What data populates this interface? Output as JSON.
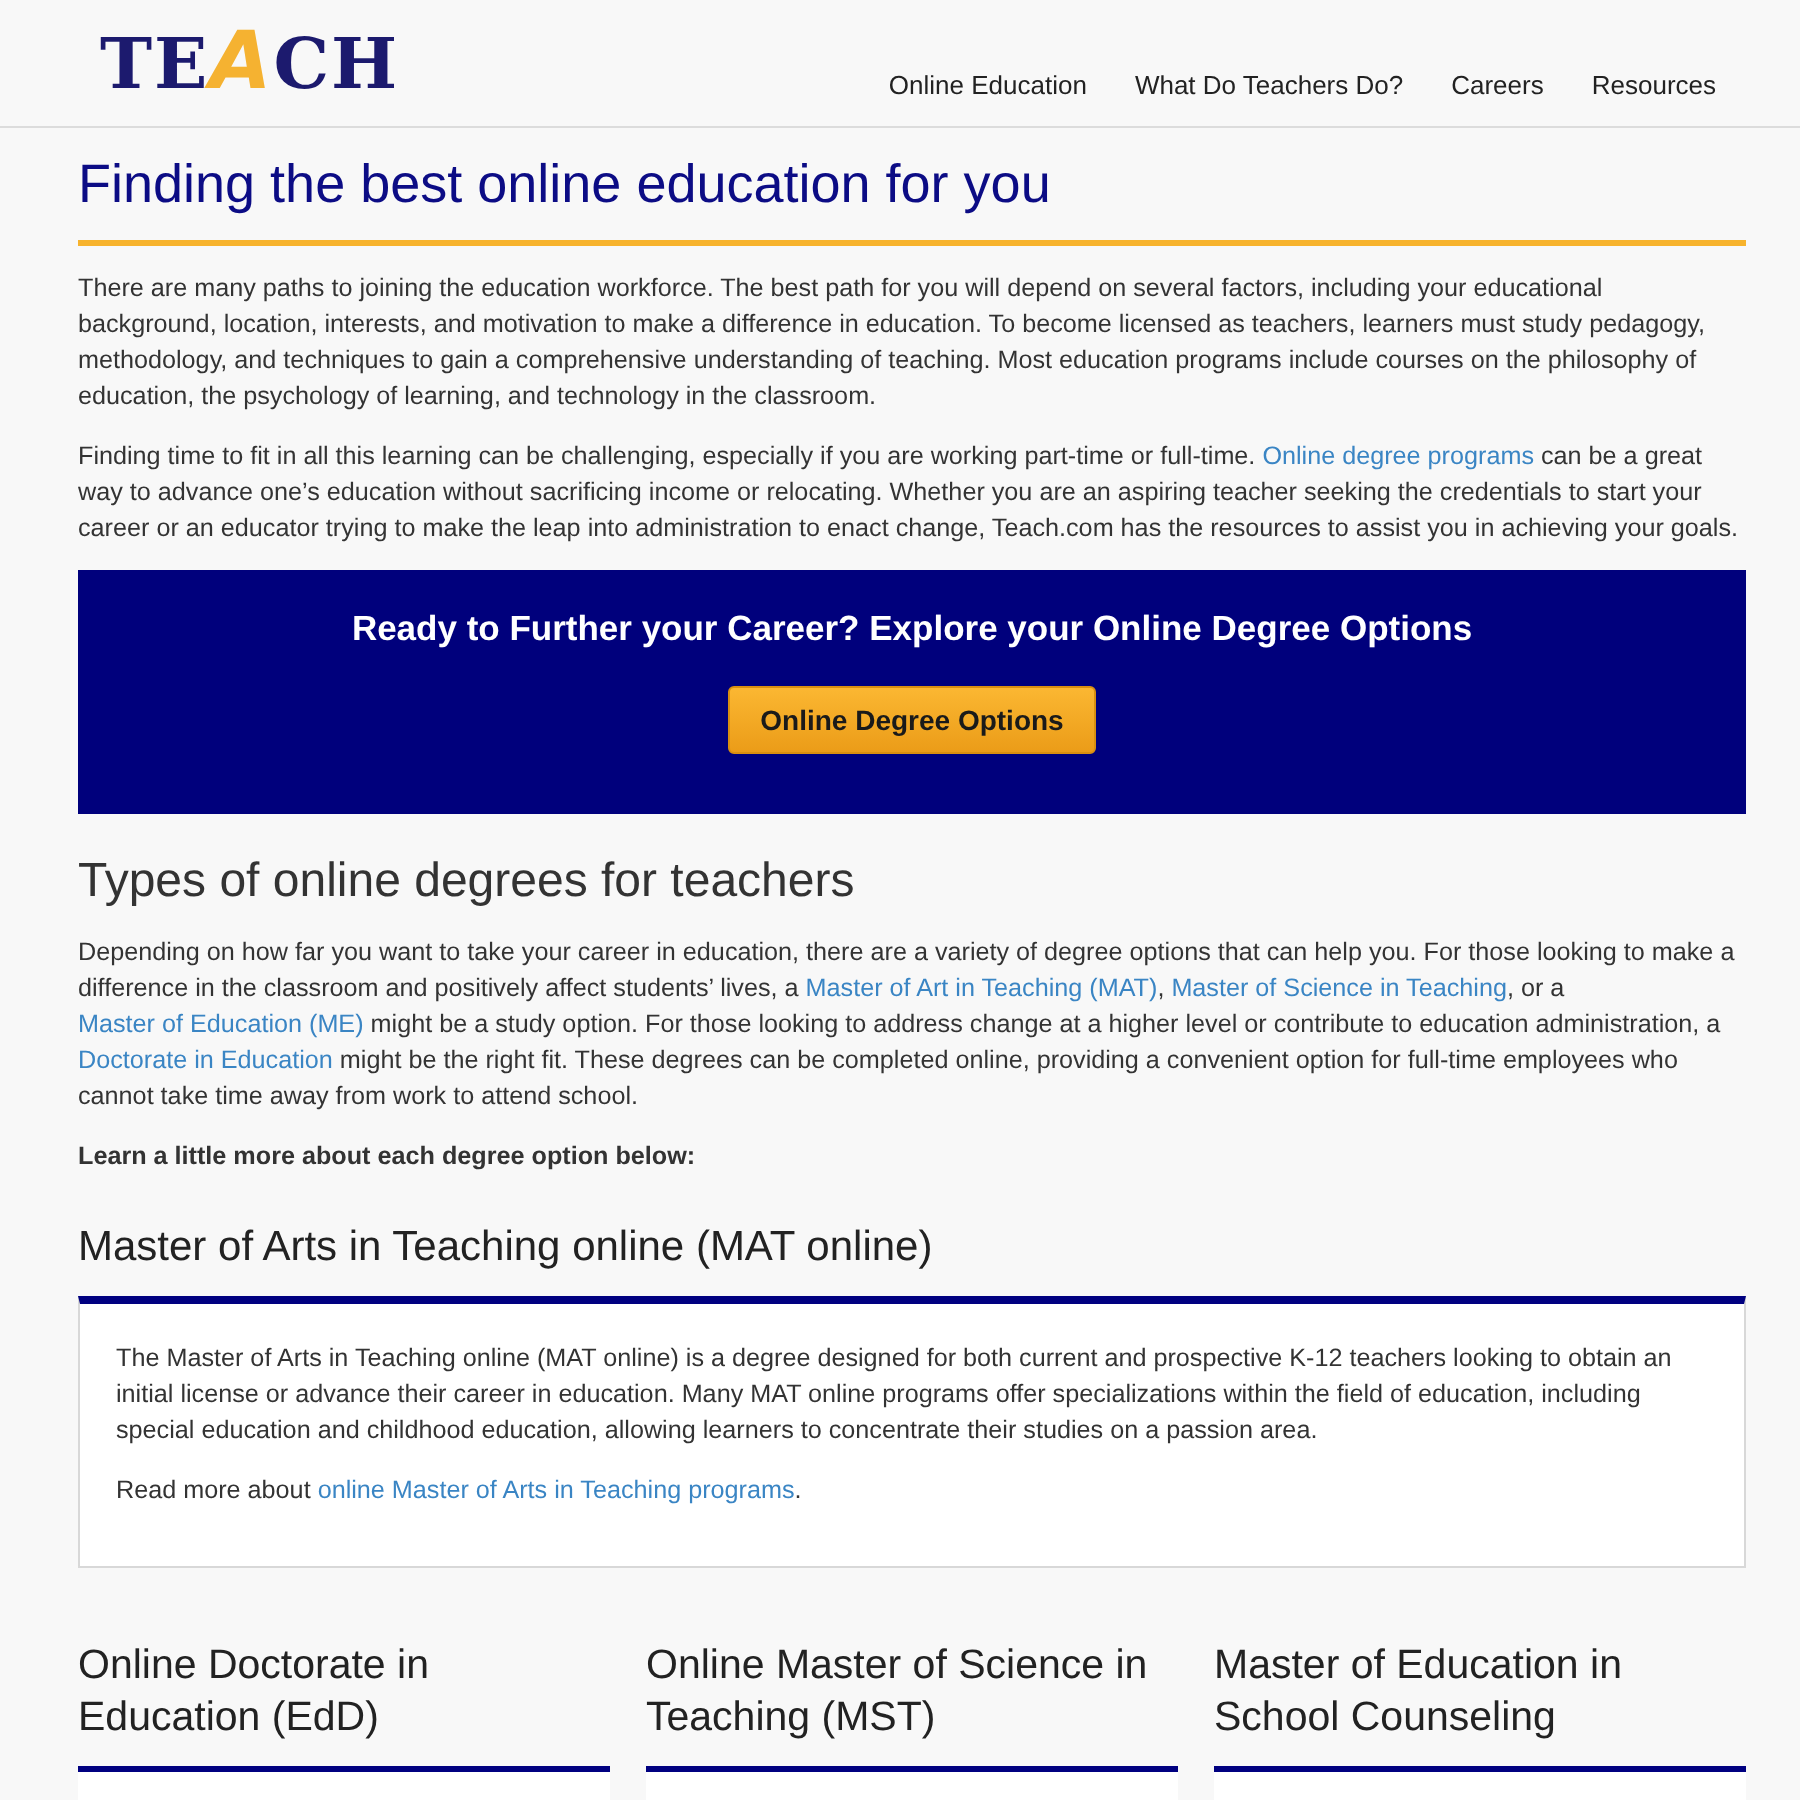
{
  "header": {
    "logo": [
      {
        "text": "TE",
        "color": "#1c1a6e"
      },
      {
        "text": "A",
        "color": "#f5b231"
      },
      {
        "text": "CH",
        "color": "#1c1a6e"
      }
    ],
    "nav": [
      {
        "label": "Online Education"
      },
      {
        "label": "What Do Teachers Do?"
      },
      {
        "label": "Careers"
      },
      {
        "label": "Resources"
      }
    ]
  },
  "intro": {
    "title": "Finding the best online education for you",
    "paragraphs": [
      [
        {
          "kind": "text",
          "text": "There are many paths to joining the education workforce. The best path for you will depend on several factors, including your educational background, location, interests, and motivation to make a difference in education. To become licensed as teachers, learners must study pedagogy, methodology, and techniques to gain a comprehensive understanding of teaching. Most education programs include courses on the philosophy of education, the psychology of learning, and technology in the classroom."
        }
      ],
      [
        {
          "kind": "text",
          "text": "Finding time to fit in all this learning can be challenging, especially if you are working part-time or full-time. "
        },
        {
          "kind": "link",
          "text": "Online degree programs"
        },
        {
          "kind": "text",
          "text": " can be a great way to advance one’s education without sacrificing income or relocating. Whether you are an aspiring teacher seeking the credentials to start your career or an educator trying to make the leap into administration to enact change, Teach.com has the resources to assist you in achieving your goals."
        }
      ]
    ]
  },
  "banner": {
    "title": "Ready to Further your Career? Explore your Online Degree Options",
    "button": "Online Degree Options"
  },
  "degree_types": {
    "title": "Types of online degrees for teachers",
    "paragraphs": [
      [
        {
          "kind": "text",
          "text": "Depending on how far you want to take your career in education, there are a variety of degree options that can help you. For those looking to make a difference in the classroom and positively affect students’ lives, a "
        },
        {
          "kind": "link",
          "text": "Master of Art in Teaching (MAT)"
        },
        {
          "kind": "text",
          "text": ", "
        },
        {
          "kind": "link",
          "text": "Master of Science in Teaching"
        },
        {
          "kind": "text",
          "text": ", or a "
        },
        {
          "kind": "link",
          "text": "Master of Education (ME)"
        },
        {
          "kind": "text",
          "text": " might be a study option. For those looking to address change at a higher level or contribute to education administration, a "
        },
        {
          "kind": "link",
          "text": "Doctorate in Education"
        },
        {
          "kind": "text",
          "text": " might be the right fit. These degrees can be completed online, providing a convenient option for full-time employees who cannot take time away from work to attend school."
        }
      ]
    ],
    "lead": "Learn a little more about each degree option below:"
  },
  "featured_program": {
    "title": "Master of Arts in Teaching online (MAT online)",
    "paragraphs": [
      [
        {
          "kind": "text",
          "text": "The Master of Arts in Teaching online (MAT online) is a degree designed for both current and prospective K-12 teachers looking to obtain an initial license or advance their career in education. Many MAT online programs offer specializations within the field of education, including special education and childhood education, allowing learners to concentrate their studies on a passion area."
        }
      ],
      [
        {
          "kind": "text",
          "text": "Read more about "
        },
        {
          "kind": "link",
          "text": "online Master of Arts in Teaching programs"
        },
        {
          "kind": "text",
          "text": "."
        }
      ]
    ]
  },
  "programs": [
    {
      "title": "Online Doctorate in Education (EdD)"
    },
    {
      "title": "Online Master of Science in Teaching (MST)"
    },
    {
      "title": "Master of Education in School Counseling"
    }
  ]
}
